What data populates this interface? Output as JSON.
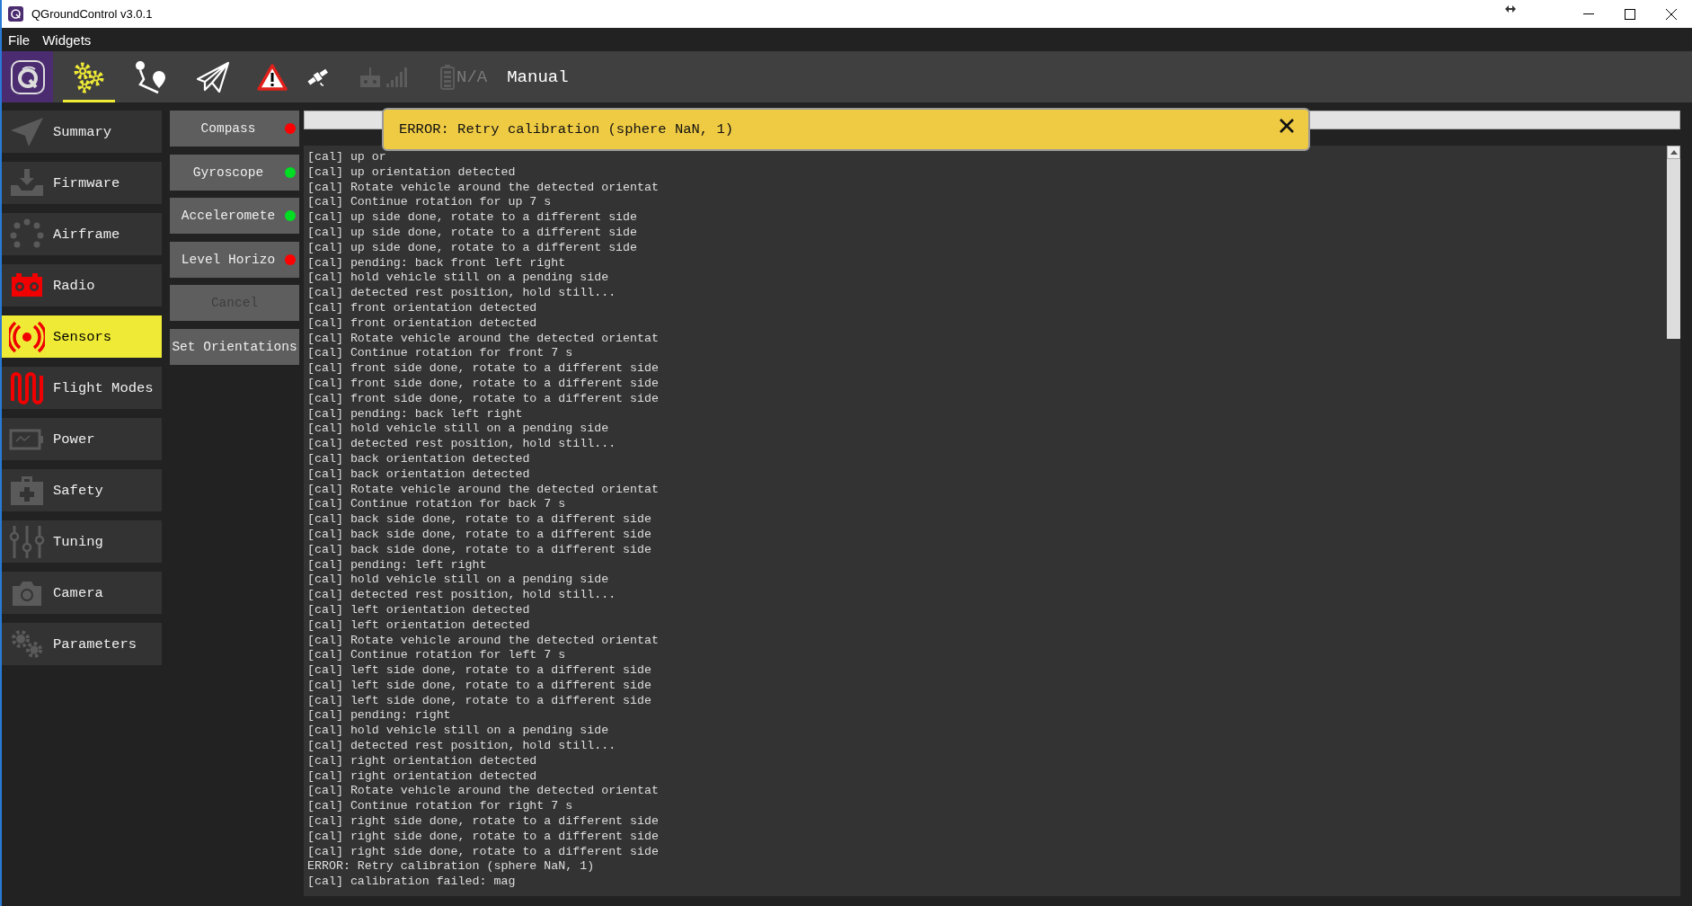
{
  "window": {
    "title": "QGroundControl v3.0.1"
  },
  "menu": [
    "File",
    "Widgets"
  ],
  "toolbar": {
    "views": [
      {
        "selected": true
      },
      {
        "selected": false
      },
      {
        "selected": false
      }
    ],
    "battery": "N/A",
    "flight_mode": "Manual"
  },
  "sidebar": {
    "items": [
      {
        "label": "Summary",
        "selected": false,
        "needs_setup": false
      },
      {
        "label": "Firmware",
        "selected": false,
        "needs_setup": false
      },
      {
        "label": "Airframe",
        "selected": false,
        "needs_setup": false
      },
      {
        "label": "Radio",
        "selected": false,
        "needs_setup": true
      },
      {
        "label": "Sensors",
        "selected": true,
        "needs_setup": true
      },
      {
        "label": "Flight Modes",
        "selected": false,
        "needs_setup": true
      },
      {
        "label": "Power",
        "selected": false,
        "needs_setup": false
      },
      {
        "label": "Safety",
        "selected": false,
        "needs_setup": false
      },
      {
        "label": "Tuning",
        "selected": false,
        "needs_setup": false
      },
      {
        "label": "Camera",
        "selected": false,
        "needs_setup": false
      },
      {
        "label": "Parameters",
        "selected": false,
        "needs_setup": false
      }
    ]
  },
  "sensors": {
    "buttons": [
      {
        "label": "Compass",
        "disabled": false,
        "color": "#ff0000"
      },
      {
        "label": "Gyroscope",
        "disabled": false,
        "color": "#00dd22"
      },
      {
        "label": "Acceleromete",
        "disabled": false,
        "color": "#00dd22"
      },
      {
        "label": "Level Horizo",
        "disabled": false,
        "color": "#ff0000"
      },
      {
        "label": "Cancel",
        "disabled": true
      },
      {
        "label": "Set Orientations",
        "disabled": false
      }
    ]
  },
  "progress": {
    "level": 0
  },
  "log": {
    "lines": [
      "[cal] up or",
      "[cal] up orientation detected",
      "[cal] Rotate vehicle around the detected orientat",
      "[cal] Continue rotation for up 7 s",
      "[cal] up side done, rotate to a different side",
      "[cal] up side done, rotate to a different side",
      "[cal] up side done, rotate to a different side",
      "[cal] pending: back front left right",
      "[cal] hold vehicle still on a pending side",
      "[cal] detected rest position, hold still...",
      "[cal] front orientation detected",
      "[cal] front orientation detected",
      "[cal] Rotate vehicle around the detected orientat",
      "[cal] Continue rotation for front 7 s",
      "[cal] front side done, rotate to a different side",
      "[cal] front side done, rotate to a different side",
      "[cal] front side done, rotate to a different side",
      "[cal] pending: back left right",
      "[cal] hold vehicle still on a pending side",
      "[cal] detected rest position, hold still...",
      "[cal] back orientation detected",
      "[cal] back orientation detected",
      "[cal] Rotate vehicle around the detected orientat",
      "[cal] Continue rotation for back 7 s",
      "[cal] back side done, rotate to a different side",
      "[cal] back side done, rotate to a different side",
      "[cal] back side done, rotate to a different side",
      "[cal] pending: left right",
      "[cal] hold vehicle still on a pending side",
      "[cal] detected rest position, hold still...",
      "[cal] left orientation detected",
      "[cal] left orientation detected",
      "[cal] Rotate vehicle around the detected orientat",
      "[cal] Continue rotation for left 7 s",
      "[cal] left side done, rotate to a different side",
      "[cal] left side done, rotate to a different side",
      "[cal] left side done, rotate to a different side",
      "[cal] pending: right",
      "[cal] hold vehicle still on a pending side",
      "[cal] detected rest position, hold still...",
      "[cal] right orientation detected",
      "[cal] right orientation detected",
      "[cal] Rotate vehicle around the detected orientat",
      "[cal] Continue rotation for right 7 s",
      "[cal] right side done, rotate to a different side",
      "[cal] right side done, rotate to a different side",
      "[cal] right side done, rotate to a different side",
      "ERROR: Retry calibration (sphere NaN, 1)",
      "[cal] calibration failed: mag"
    ]
  },
  "popup": {
    "message": "ERROR: Retry calibration (sphere NaN, 1)"
  }
}
